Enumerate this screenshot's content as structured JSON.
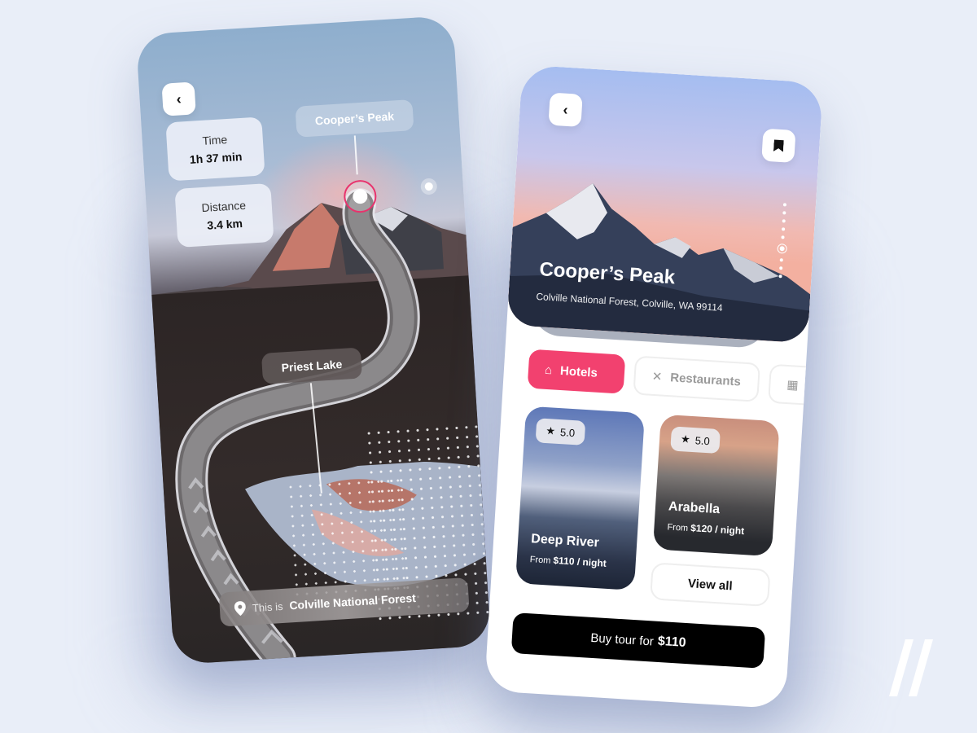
{
  "colors": {
    "background": "#e9eef8",
    "accent": "#f2416f",
    "target_ring": "#e8336d",
    "primary_button": "#000000"
  },
  "map_screen": {
    "back_icon": "chevron-left-icon",
    "stats": [
      {
        "label": "Time",
        "value": "1h 37 min"
      },
      {
        "label": "Distance",
        "value": "3.4 km"
      }
    ],
    "waypoints": [
      {
        "label": "Cooper’s Peak"
      },
      {
        "label": "Priest Lake"
      }
    ],
    "location_bar": {
      "icon": "map-pin-icon",
      "prefix": "This is",
      "place": "Colville National Forest"
    }
  },
  "detail_screen": {
    "back_icon": "chevron-left-icon",
    "bookmark_icon": "bookmark-icon",
    "title": "Cooper’s Peak",
    "subtitle": "Colville National Forest, Colville, WA 99114",
    "carousel": {
      "total": 9,
      "active_index": 5
    },
    "tabs": [
      {
        "label": "Hotels",
        "icon": "home-icon",
        "active": true
      },
      {
        "label": "Restaurants",
        "icon": "utensils-icon",
        "active": false
      },
      {
        "label": "",
        "icon": "more-category-icon",
        "active": false
      }
    ],
    "hotels": [
      {
        "name": "Deep River",
        "rating": "5.0",
        "price_prefix": "From",
        "price": "$110 / night"
      },
      {
        "name": "Arabella",
        "rating": "5.0",
        "price_prefix": "From",
        "price": "$120 / night"
      }
    ],
    "view_all_label": "View all",
    "buy_button": {
      "prefix": "Buy tour for",
      "price": "$110"
    }
  },
  "brand": {
    "icon": "double-slash-logo-icon"
  }
}
